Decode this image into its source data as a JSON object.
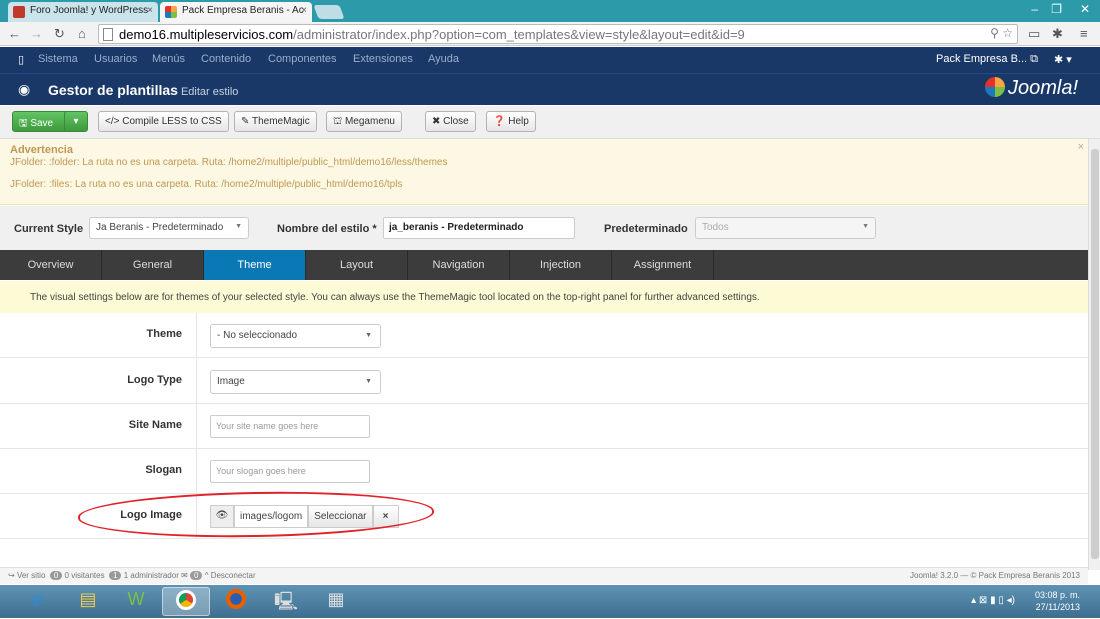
{
  "browser": {
    "tabs": [
      {
        "label": "Foro Joomla! y WordPress",
        "close": "×"
      },
      {
        "label": "Pack Empresa Beranis - Ac",
        "close": "×"
      }
    ],
    "url_domain": "demo16.multipleservicios.com",
    "url_path": "/administrator/index.php?option=com_templates&view=style&layout=edit&id=9",
    "window_controls": [
      "–",
      "❐",
      "✕"
    ]
  },
  "jmenu": {
    "toggle": "▯",
    "items": [
      "Sistema",
      "Usuarios",
      "Menús",
      "Contenido",
      "Componentes",
      "Extensiones",
      "Ayuda"
    ],
    "site_link": "Pack Empresa B...",
    "gear": "✱ ▾"
  },
  "header": {
    "title": "Gestor de plantillas",
    "subtitle": "Editar estilo",
    "logo": "Joomla!"
  },
  "toolbar": {
    "save": "Save",
    "compile": "</> Compile LESS to CSS",
    "thememagic": "ThemeMagic",
    "megamenu": "Megamenu",
    "close": "Close",
    "help": "Help"
  },
  "warning": {
    "title": "Advertencia",
    "line1": "JFolder: :folder: La ruta no es una carpeta. Ruta: /home2/multiple/public_html/demo16/less/themes",
    "line2": "JFolder: :files: La ruta no es una carpeta. Ruta: /home2/multiple/public_html/demo16/tpls"
  },
  "style_bar": {
    "current_style_label": "Current Style",
    "current_style_value": "Ja Beranis - Predeterminado",
    "name_label": "Nombre del estilo *",
    "name_value": "ja_beranis - Predeterminado",
    "default_label": "Predeterminado",
    "default_value": "Todos"
  },
  "tabs": [
    "Overview",
    "General",
    "Theme",
    "Layout",
    "Navigation",
    "Injection",
    "Assignment"
  ],
  "active_tab": "Theme",
  "info_text": "The visual settings below are for themes of your selected style. You can always use the ThemeMagic tool located on the top-right panel for further advanced settings.",
  "fields": {
    "theme": {
      "label": "Theme",
      "value": "- No seleccionado"
    },
    "logo_type": {
      "label": "Logo Type",
      "value": "Image"
    },
    "site_name": {
      "label": "Site Name",
      "placeholder": "Your site name goes here"
    },
    "slogan": {
      "label": "Slogan",
      "placeholder": "Your slogan goes here"
    },
    "logo_image": {
      "label": "Logo Image",
      "value": "images/logom",
      "select": "Seleccionar",
      "clear": "×"
    }
  },
  "statusbar": {
    "view_site": "Ver sitio",
    "visitors_count": "0",
    "visitors": "0 visitantes",
    "admins_count": "1",
    "admins": "1 administrador",
    "msg_count": "0",
    "logout": "Desconectar",
    "version": "Joomla! 3.2.0 — © Pack Empresa Beranis 2013"
  },
  "taskbar": {
    "time": "03:08 p. m.",
    "date": "27/11/2013"
  },
  "colors": {
    "admin_navy": "#1a3867",
    "active_tab": "#0a78b4",
    "annotation_red": "#e0232a"
  }
}
